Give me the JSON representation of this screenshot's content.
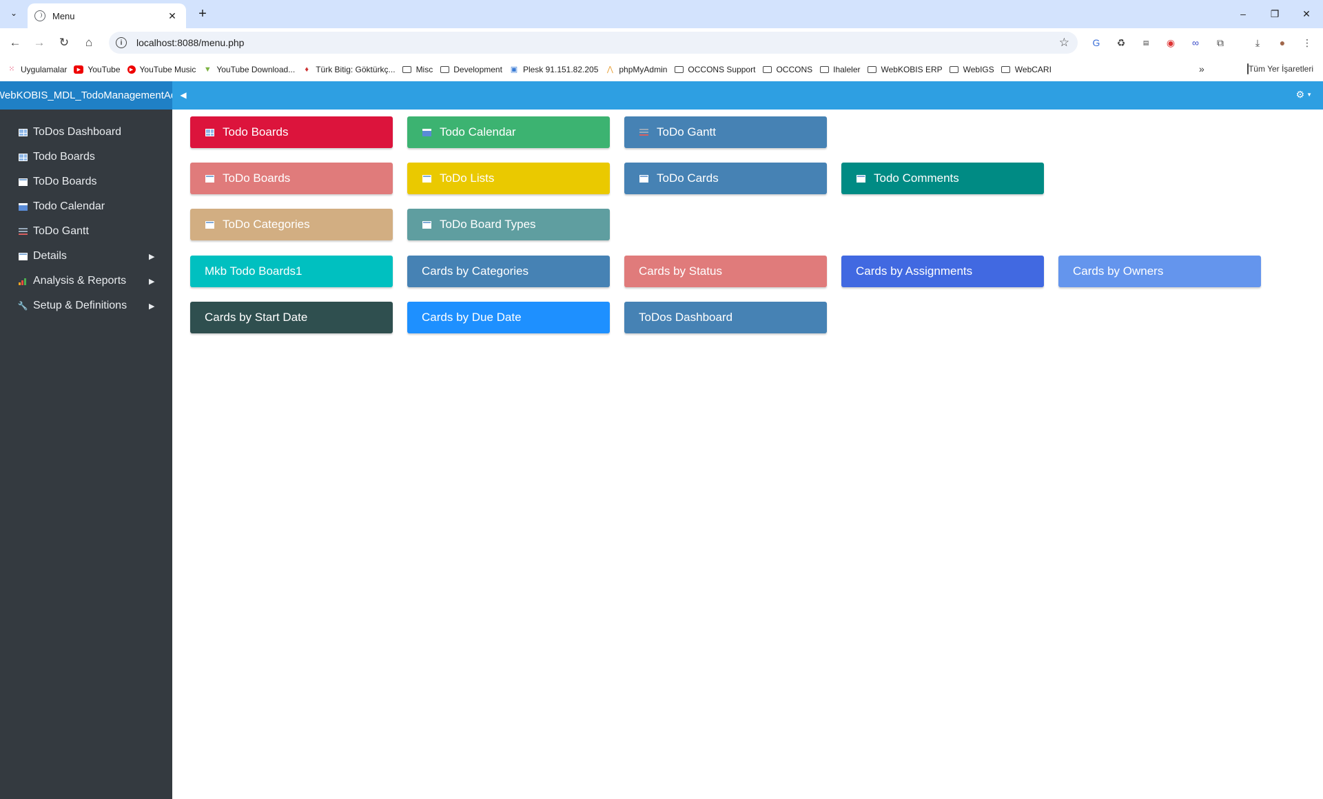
{
  "browser": {
    "tab_title": "Menu",
    "url": "localhost:8088/menu.php",
    "bookmarks": [
      {
        "label": "Uygulamalar",
        "icon": "apps-grid-icon"
      },
      {
        "label": "YouTube",
        "icon": "youtube-icon"
      },
      {
        "label": "YouTube Music",
        "icon": "youtube-music-icon"
      },
      {
        "label": "YouTube Download...",
        "icon": "download-arrow-icon"
      },
      {
        "label": "Türk Bitig: Göktürkç...",
        "icon": "gem-icon"
      },
      {
        "label": "Misc",
        "icon": "folder-icon"
      },
      {
        "label": "Development",
        "icon": "folder-icon"
      },
      {
        "label": "Plesk 91.151.82.205",
        "icon": "plesk-icon"
      },
      {
        "label": "phpMyAdmin",
        "icon": "phpmyadmin-icon"
      },
      {
        "label": "OCCONS Support",
        "icon": "folder-icon"
      },
      {
        "label": "OCCONS",
        "icon": "folder-icon"
      },
      {
        "label": "Ihaleler",
        "icon": "folder-icon"
      },
      {
        "label": "WebKOBIS ERP",
        "icon": "folder-icon"
      },
      {
        "label": "WebIGS",
        "icon": "folder-icon"
      },
      {
        "label": "WebCARI",
        "icon": "folder-icon"
      }
    ],
    "bookmarks_more": "»",
    "all_bookmarks": "Tüm Yer İşaretleri"
  },
  "app": {
    "brand": "WebKOBIS_MDL_TodoManagementAdmin",
    "header_color": "#2e9fe2"
  },
  "sidebar": {
    "items": [
      {
        "label": "ToDos Dashboard",
        "icon": "grid-icon"
      },
      {
        "label": "Todo Boards",
        "icon": "grid-icon"
      },
      {
        "label": "ToDo Boards",
        "icon": "table-icon"
      },
      {
        "label": "Todo Calendar",
        "icon": "calendar-icon"
      },
      {
        "label": "ToDo Gantt",
        "icon": "gantt-icon"
      },
      {
        "label": "Details",
        "icon": "table-icon",
        "submenu": true
      },
      {
        "label": "Analysis & Reports",
        "icon": "chart-icon",
        "submenu": true
      },
      {
        "label": "Setup & Definitions",
        "icon": "wrench-icon",
        "submenu": true
      }
    ]
  },
  "tiles": [
    {
      "label": "Todo Boards",
      "color": "#dc143c",
      "icon": "grid-icon"
    },
    {
      "label": "Todo Calendar",
      "color": "#3cb371",
      "icon": "calendar-icon"
    },
    {
      "label": "ToDo Gantt",
      "color": "#4682b4",
      "icon": "gantt-icon"
    },
    {
      "label": "ToDo Boards",
      "color": "#e07b7b",
      "icon": "table-icon"
    },
    {
      "label": "ToDo Lists",
      "color": "#eac900",
      "icon": "table-icon"
    },
    {
      "label": "ToDo Cards",
      "color": "#4682b4",
      "icon": "table-icon"
    },
    {
      "label": "Todo Comments",
      "color": "#008b84",
      "icon": "table-icon"
    },
    {
      "label": "ToDo Categories",
      "color": "#d2ae82",
      "icon": "table-icon"
    },
    {
      "label": "ToDo Board Types",
      "color": "#5f9ea0",
      "icon": "table-icon"
    },
    {
      "label": "Mkb Todo Boards1",
      "color": "#00c0c0",
      "icon": ""
    },
    {
      "label": "Cards by Categories",
      "color": "#4682b4",
      "icon": ""
    },
    {
      "label": "Cards by Status",
      "color": "#e07b7b",
      "icon": ""
    },
    {
      "label": "Cards by Assignments",
      "color": "#4169e1",
      "icon": ""
    },
    {
      "label": "Cards by Owners",
      "color": "#6495ed",
      "icon": ""
    },
    {
      "label": "Cards by Start Date",
      "color": "#2f4f4f",
      "icon": ""
    },
    {
      "label": "Cards by Due Date",
      "color": "#1e90ff",
      "icon": ""
    },
    {
      "label": "ToDos Dashboard",
      "color": "#4682b4",
      "icon": ""
    }
  ]
}
